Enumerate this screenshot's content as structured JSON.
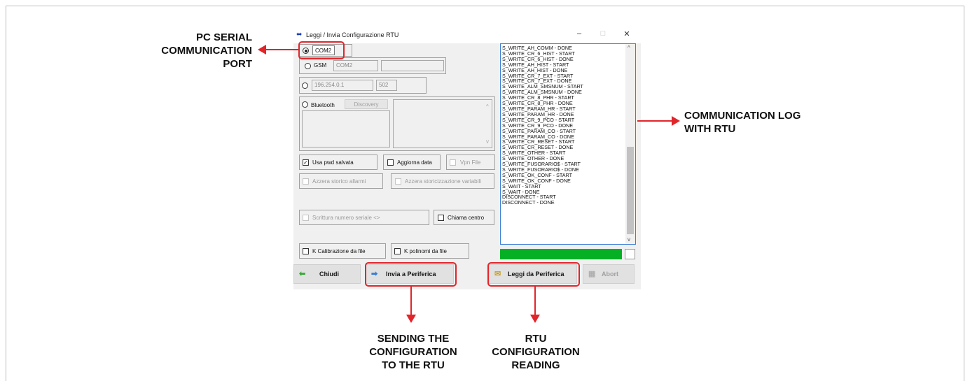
{
  "window": {
    "title": "Leggi / Invia Configurazione RTU",
    "minimize": "–",
    "maximize": "□",
    "close": "✕"
  },
  "connection": {
    "com_port": "COM2",
    "gsm_label": "GSM",
    "gsm_port": "COM2",
    "ip_address": "196.254.0.1",
    "ip_port": "502",
    "bluetooth_label": "Bluetooth",
    "discovery_label": "Discovery"
  },
  "options": {
    "use_saved_pwd": "Usa pwd salvata",
    "update_date": "Aggiorna data",
    "vpn_file": "Vpn File",
    "reset_alarm_history": "Azzera storico allarmi",
    "reset_var_history": "Azzera storicizzazione variabili",
    "serial_number_write": "Scrittura numero seriale <>",
    "call_center": "Chiama centro",
    "k_calibration": "K Calibrazione da file",
    "k_polynomials": "K polinomi da file"
  },
  "buttons": {
    "close": "Chiudi",
    "send": "Invia a Periferica",
    "read": "Leggi da Periferica",
    "abort": "Abort"
  },
  "log": {
    "lines": [
      "S_WRITE_AH_COMM - DONE",
      "S_WRITE_CR_6_HIST - START",
      "S_WRITE_CR_6_HIST - DONE",
      "S_WRITE_AH_HIST - START",
      "S_WRITE_AH_HIST - DONE",
      "S_WRITE_CR_7_EXT - START",
      "S_WRITE_CR_7_EXT - DONE",
      "S_WRITE_ALM_SMSNUM - START",
      "S_WRITE_ALM_SMSNUM - DONE",
      "S_WRITE_CR_8_PHR - START",
      "S_WRITE_CR_8_PHR - DONE",
      "S_WRITE_PARAM_HR - START",
      "S_WRITE_PARAM_HR - DONE",
      "S_WRITE_CR_9_PCO - START",
      "S_WRITE_CR_9_PCO - DONE",
      "S_WRITE_PARAM_CO - START",
      "S_WRITE_PARAM_CO - DONE",
      "S_WRITE_CR_RESET - START",
      "S_WRITE_CR_RESET - DONE",
      "S_WRITE_OTHER - START",
      "S_WRITE_OTHER - DONE",
      "S_WRITE_FUSORARIO$ - START",
      "S_WRITE_FUSORARIO$ - DONE",
      "S_WRITE_OK_CONF - START",
      "S_WRITE_OK_CONF - DONE",
      "S_WAIT - START",
      "S_WAIT - DONE",
      "DISCONNECT - START",
      "DISCONNECT - DONE"
    ],
    "progress": 1.0
  },
  "annotations": {
    "serial_port": "PC SERIAL\nCOMMUNICATION\nPORT",
    "comm_log": "COMMUNICATION LOG\nWITH RTU",
    "sending": "SENDING THE\nCONFIGURATION\nTO THE RTU",
    "reading": "RTU\nCONFIGURATION\nREADING"
  },
  "colors": {
    "annotation_red": "#e0252b",
    "progress_green": "#06b025",
    "log_border": "#3c7fd6"
  }
}
